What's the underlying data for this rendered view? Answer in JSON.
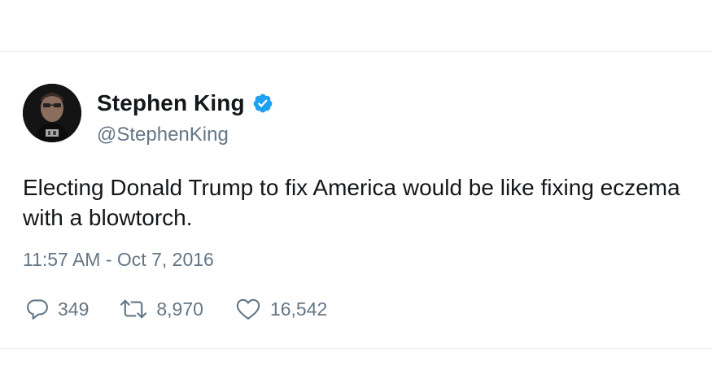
{
  "tweet": {
    "author": {
      "display_name": "Stephen King",
      "handle": "@StephenKing",
      "verified": true,
      "avatar_icon": "author-photo"
    },
    "text": "Electing Donald Trump to fix America would be like fixing eczema with a blowtorch.",
    "timestamp": "11:57 AM - Oct 7, 2016",
    "actions": {
      "reply": {
        "icon": "reply-icon",
        "count": "349"
      },
      "retweet": {
        "icon": "retweet-icon",
        "count": "8,970"
      },
      "like": {
        "icon": "heart-icon",
        "count": "16,542"
      }
    }
  },
  "colors": {
    "text": "#14171a",
    "secondary_text": "#657786",
    "verified_badge": "#1da1f2",
    "divider": "#e6ecf0"
  }
}
